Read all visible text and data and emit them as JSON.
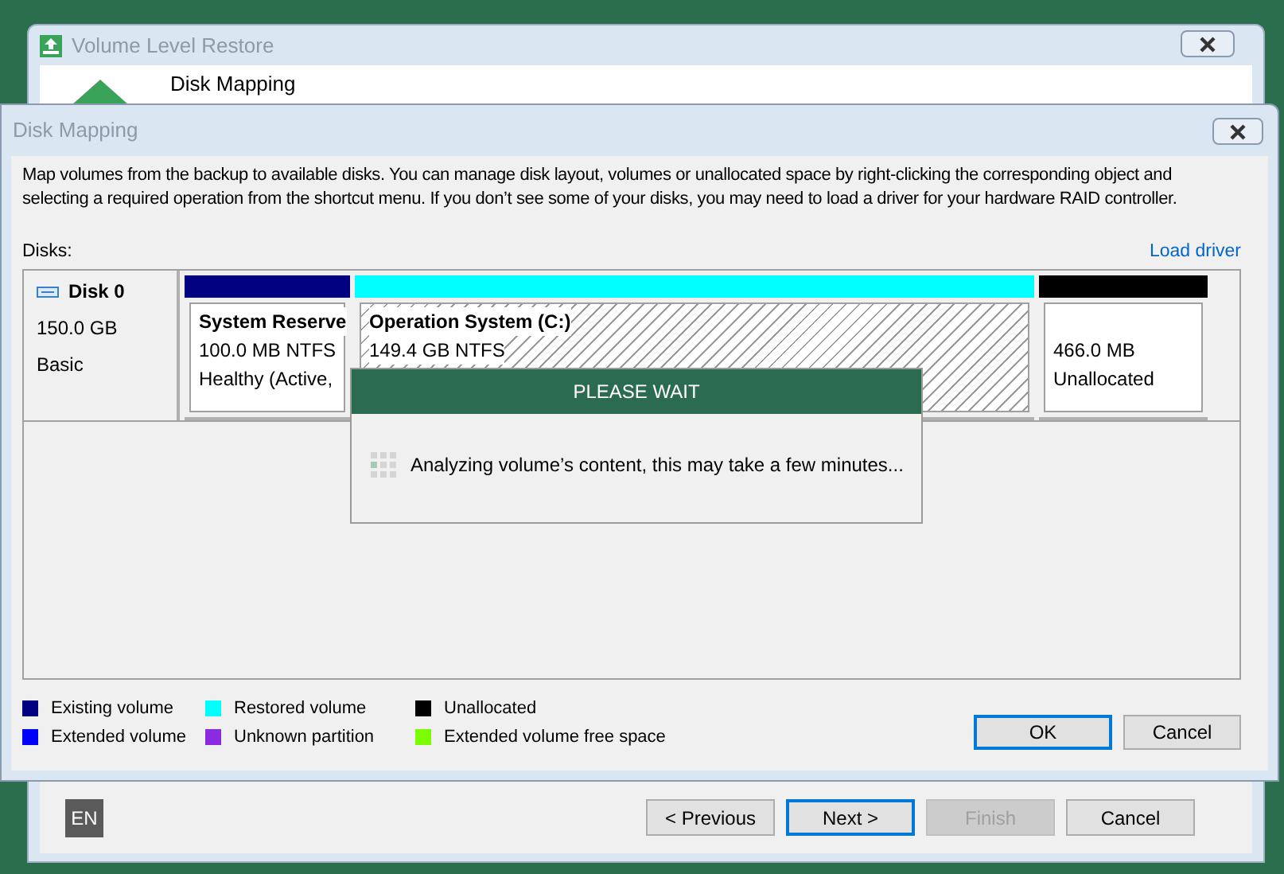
{
  "back_window": {
    "title": "Volume Level Restore",
    "header_title": "Disk Mapping"
  },
  "dialog": {
    "title": "Disk Mapping",
    "description": "Map volumes from the backup to available disks. You can manage disk layout, volumes or unallocated space by right-clicking the corresponding object and selecting a required operation from the shortcut menu. If you don’t see some of your disks, you may need to load a driver for your hardware RAID controller.",
    "disks_label": "Disks:",
    "load_driver": "Load driver",
    "disks": [
      {
        "name": "Disk 0",
        "size": "150.0 GB",
        "type": "Basic",
        "partitions": [
          {
            "lines": [
              "System Reserve",
              "100.0 MB NTFS",
              "Healthy (Active,"
            ],
            "color": "#000080",
            "hatched": false,
            "kind": "volume"
          },
          {
            "lines": [
              "Operation System (C:)",
              "149.4 GB NTFS"
            ],
            "color": "#00ffff",
            "hatched": true,
            "kind": "volume"
          },
          {
            "lines": [
              "466.0 MB",
              "Unallocated"
            ],
            "color": "#000000",
            "hatched": false,
            "kind": "unallocated"
          }
        ]
      }
    ],
    "legend": [
      {
        "label": "Existing volume",
        "color": "#000080"
      },
      {
        "label": "Extended volume",
        "color": "#0000ff"
      },
      {
        "label": "Restored volume",
        "color": "#00ffff"
      },
      {
        "label": "Unknown partition",
        "color": "#8a2be2"
      },
      {
        "label": "Unallocated",
        "color": "#000000"
      },
      {
        "label": "Extended volume free space",
        "color": "#7cfc00"
      }
    ],
    "buttons": [
      {
        "label": "OK",
        "default": true
      },
      {
        "label": "Cancel",
        "default": false
      }
    ]
  },
  "wait_dialog": {
    "title": "PLEASE WAIT",
    "message": "Analyzing volume’s content, this may take a few minutes..."
  },
  "footer": {
    "language": "EN",
    "buttons": [
      {
        "label": "< Previous",
        "disabled": false,
        "default": false
      },
      {
        "label": "Next >",
        "disabled": false,
        "default": true
      },
      {
        "label": "Finish",
        "disabled": true,
        "default": false
      },
      {
        "label": "Cancel",
        "disabled": false,
        "default": false
      }
    ]
  }
}
